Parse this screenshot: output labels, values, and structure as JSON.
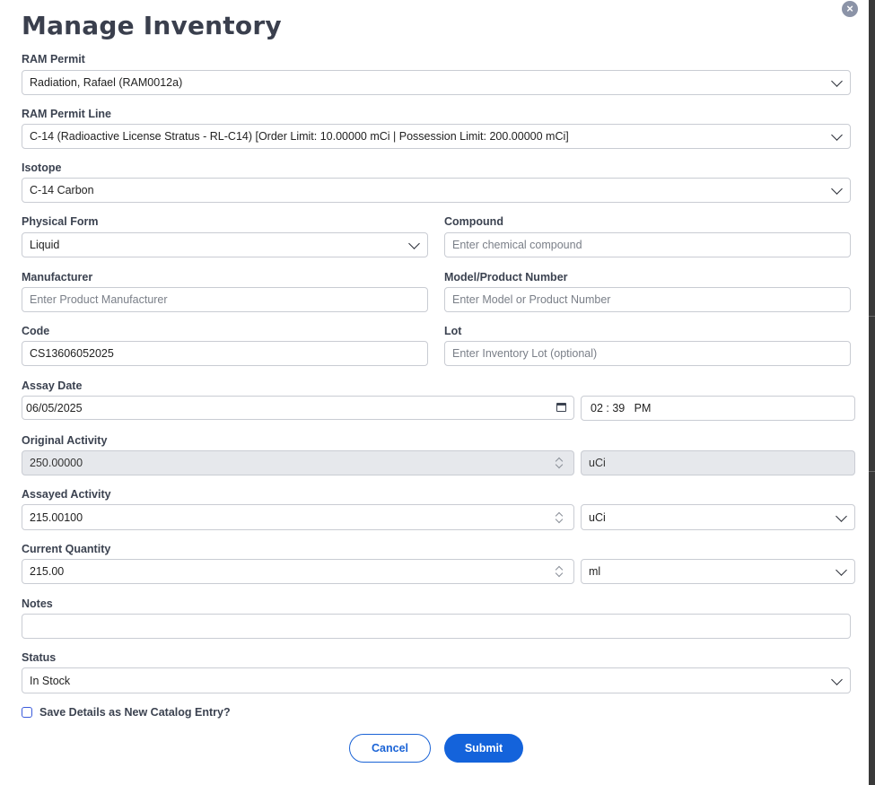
{
  "title": "Manage Inventory",
  "close_icon": "×",
  "ram_permit": {
    "label": "RAM Permit",
    "value": "Radiation, Rafael (RAM0012a)"
  },
  "ram_permit_line": {
    "label": "RAM Permit Line",
    "value": "C-14 (Radioactive License Stratus - RL-C14) [Order Limit: 10.00000 mCi | Possession Limit: 200.00000 mCi]"
  },
  "isotope": {
    "label": "Isotope",
    "value": "C-14 Carbon"
  },
  "physical_form": {
    "label": "Physical Form",
    "value": "Liquid"
  },
  "compound": {
    "label": "Compound",
    "placeholder": "Enter chemical compound"
  },
  "manufacturer": {
    "label": "Manufacturer",
    "placeholder": "Enter Product Manufacturer"
  },
  "model_number": {
    "label": "Model/Product Number",
    "placeholder": "Enter Model or Product Number"
  },
  "code": {
    "label": "Code",
    "value": "CS13606052025"
  },
  "lot": {
    "label": "Lot",
    "placeholder": "Enter Inventory Lot (optional)"
  },
  "assay_date": {
    "label": "Assay Date",
    "date": "06/05/2025",
    "time": "02 : 39   PM"
  },
  "original_activity": {
    "label": "Original Activity",
    "value": "250.00000",
    "unit": "uCi"
  },
  "assayed_activity": {
    "label": "Assayed Activity",
    "value": "215.00100",
    "unit": "uCi"
  },
  "current_quantity": {
    "label": "Current Quantity",
    "value": "215.00",
    "unit": "ml"
  },
  "notes": {
    "label": "Notes",
    "value": ""
  },
  "status": {
    "label": "Status",
    "value": "In Stock"
  },
  "save_catalog": {
    "label": "Save Details as New Catalog Entry?",
    "checked": false
  },
  "buttons": {
    "cancel": "Cancel",
    "submit": "Submit"
  },
  "colors": {
    "primary": "#1463db",
    "title": "#3a3f4d",
    "readonly_bg": "#e6e8ec"
  }
}
